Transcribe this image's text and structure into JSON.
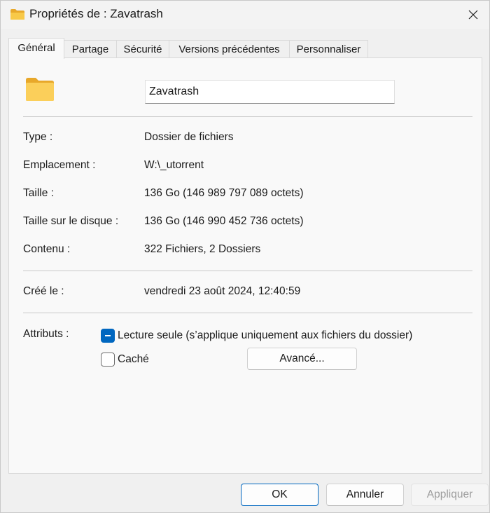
{
  "window": {
    "title": "Propriétés de : Zavatrash"
  },
  "tabs": [
    {
      "label": "Général",
      "active": true
    },
    {
      "label": "Partage",
      "active": false
    },
    {
      "label": "Sécurité",
      "active": false
    },
    {
      "label": "Versions précédentes",
      "active": false
    },
    {
      "label": "Personnaliser",
      "active": false
    }
  ],
  "general": {
    "folder_name": "Zavatrash",
    "folder_icon": "folder-icon",
    "properties": [
      {
        "label": "Type :",
        "value": "Dossier de fichiers"
      },
      {
        "label": "Emplacement :",
        "value": "W:\\_utorrent"
      },
      {
        "label": "Taille :",
        "value": "136 Go (146 989 797 089 octets)"
      },
      {
        "label": "Taille sur le disque :",
        "value": "136 Go (146 990 452 736 octets)"
      },
      {
        "label": "Contenu :",
        "value": "322 Fichiers, 2 Dossiers"
      }
    ],
    "created": {
      "label": "Créé le :",
      "value": "vendredi 23 août 2024, 12:40:59"
    },
    "attributes": {
      "label": "Attributs :",
      "read_only": {
        "label": "Lecture seule (s’applique uniquement aux fichiers du dossier)",
        "state": "indeterminate"
      },
      "hidden": {
        "label": "Caché",
        "state": "unchecked"
      },
      "advanced_label": "Avancé..."
    }
  },
  "footer": {
    "ok_label": "OK",
    "cancel_label": "Annuler",
    "apply_label": "Appliquer"
  },
  "colors": {
    "accent": "#0067c0",
    "folder": "#f8c948"
  }
}
